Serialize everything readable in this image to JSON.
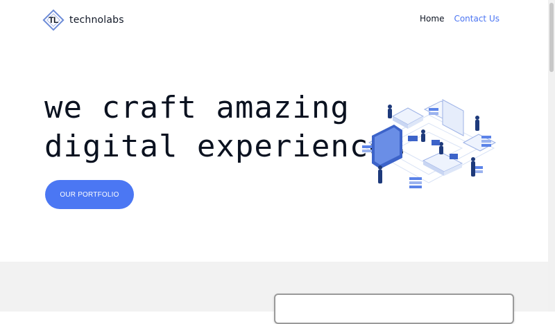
{
  "brand": {
    "logo_letters": "TL",
    "name": "technolabs"
  },
  "nav": {
    "home": "Home",
    "contact": "Contact Us"
  },
  "hero": {
    "title_line1": "we craft amazing",
    "title_line2": "digital experiences",
    "cta_label": "OUR PORTFOLIO"
  },
  "colors": {
    "accent": "#4b77f3",
    "link": "#4a74f2",
    "text": "#0b1220",
    "section_bg": "#f2f2f2"
  },
  "icons": {
    "illustration": "isometric-office-illustration"
  }
}
